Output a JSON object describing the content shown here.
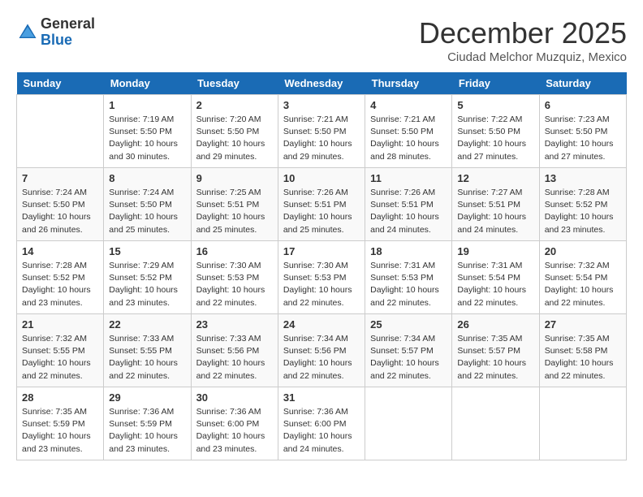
{
  "logo": {
    "general": "General",
    "blue": "Blue"
  },
  "title": "December 2025",
  "subtitle": "Ciudad Melchor Muzquiz, Mexico",
  "headers": [
    "Sunday",
    "Monday",
    "Tuesday",
    "Wednesday",
    "Thursday",
    "Friday",
    "Saturday"
  ],
  "weeks": [
    [
      {
        "day": "",
        "info": ""
      },
      {
        "day": "1",
        "info": "Sunrise: 7:19 AM\nSunset: 5:50 PM\nDaylight: 10 hours\nand 30 minutes."
      },
      {
        "day": "2",
        "info": "Sunrise: 7:20 AM\nSunset: 5:50 PM\nDaylight: 10 hours\nand 29 minutes."
      },
      {
        "day": "3",
        "info": "Sunrise: 7:21 AM\nSunset: 5:50 PM\nDaylight: 10 hours\nand 29 minutes."
      },
      {
        "day": "4",
        "info": "Sunrise: 7:21 AM\nSunset: 5:50 PM\nDaylight: 10 hours\nand 28 minutes."
      },
      {
        "day": "5",
        "info": "Sunrise: 7:22 AM\nSunset: 5:50 PM\nDaylight: 10 hours\nand 27 minutes."
      },
      {
        "day": "6",
        "info": "Sunrise: 7:23 AM\nSunset: 5:50 PM\nDaylight: 10 hours\nand 27 minutes."
      }
    ],
    [
      {
        "day": "7",
        "info": "Sunrise: 7:24 AM\nSunset: 5:50 PM\nDaylight: 10 hours\nand 26 minutes."
      },
      {
        "day": "8",
        "info": "Sunrise: 7:24 AM\nSunset: 5:50 PM\nDaylight: 10 hours\nand 25 minutes."
      },
      {
        "day": "9",
        "info": "Sunrise: 7:25 AM\nSunset: 5:51 PM\nDaylight: 10 hours\nand 25 minutes."
      },
      {
        "day": "10",
        "info": "Sunrise: 7:26 AM\nSunset: 5:51 PM\nDaylight: 10 hours\nand 25 minutes."
      },
      {
        "day": "11",
        "info": "Sunrise: 7:26 AM\nSunset: 5:51 PM\nDaylight: 10 hours\nand 24 minutes."
      },
      {
        "day": "12",
        "info": "Sunrise: 7:27 AM\nSunset: 5:51 PM\nDaylight: 10 hours\nand 24 minutes."
      },
      {
        "day": "13",
        "info": "Sunrise: 7:28 AM\nSunset: 5:52 PM\nDaylight: 10 hours\nand 23 minutes."
      }
    ],
    [
      {
        "day": "14",
        "info": "Sunrise: 7:28 AM\nSunset: 5:52 PM\nDaylight: 10 hours\nand 23 minutes."
      },
      {
        "day": "15",
        "info": "Sunrise: 7:29 AM\nSunset: 5:52 PM\nDaylight: 10 hours\nand 23 minutes."
      },
      {
        "day": "16",
        "info": "Sunrise: 7:30 AM\nSunset: 5:53 PM\nDaylight: 10 hours\nand 22 minutes."
      },
      {
        "day": "17",
        "info": "Sunrise: 7:30 AM\nSunset: 5:53 PM\nDaylight: 10 hours\nand 22 minutes."
      },
      {
        "day": "18",
        "info": "Sunrise: 7:31 AM\nSunset: 5:53 PM\nDaylight: 10 hours\nand 22 minutes."
      },
      {
        "day": "19",
        "info": "Sunrise: 7:31 AM\nSunset: 5:54 PM\nDaylight: 10 hours\nand 22 minutes."
      },
      {
        "day": "20",
        "info": "Sunrise: 7:32 AM\nSunset: 5:54 PM\nDaylight: 10 hours\nand 22 minutes."
      }
    ],
    [
      {
        "day": "21",
        "info": "Sunrise: 7:32 AM\nSunset: 5:55 PM\nDaylight: 10 hours\nand 22 minutes."
      },
      {
        "day": "22",
        "info": "Sunrise: 7:33 AM\nSunset: 5:55 PM\nDaylight: 10 hours\nand 22 minutes."
      },
      {
        "day": "23",
        "info": "Sunrise: 7:33 AM\nSunset: 5:56 PM\nDaylight: 10 hours\nand 22 minutes."
      },
      {
        "day": "24",
        "info": "Sunrise: 7:34 AM\nSunset: 5:56 PM\nDaylight: 10 hours\nand 22 minutes."
      },
      {
        "day": "25",
        "info": "Sunrise: 7:34 AM\nSunset: 5:57 PM\nDaylight: 10 hours\nand 22 minutes."
      },
      {
        "day": "26",
        "info": "Sunrise: 7:35 AM\nSunset: 5:57 PM\nDaylight: 10 hours\nand 22 minutes."
      },
      {
        "day": "27",
        "info": "Sunrise: 7:35 AM\nSunset: 5:58 PM\nDaylight: 10 hours\nand 22 minutes."
      }
    ],
    [
      {
        "day": "28",
        "info": "Sunrise: 7:35 AM\nSunset: 5:59 PM\nDaylight: 10 hours\nand 23 minutes."
      },
      {
        "day": "29",
        "info": "Sunrise: 7:36 AM\nSunset: 5:59 PM\nDaylight: 10 hours\nand 23 minutes."
      },
      {
        "day": "30",
        "info": "Sunrise: 7:36 AM\nSunset: 6:00 PM\nDaylight: 10 hours\nand 23 minutes."
      },
      {
        "day": "31",
        "info": "Sunrise: 7:36 AM\nSunset: 6:00 PM\nDaylight: 10 hours\nand 24 minutes."
      },
      {
        "day": "",
        "info": ""
      },
      {
        "day": "",
        "info": ""
      },
      {
        "day": "",
        "info": ""
      }
    ]
  ]
}
